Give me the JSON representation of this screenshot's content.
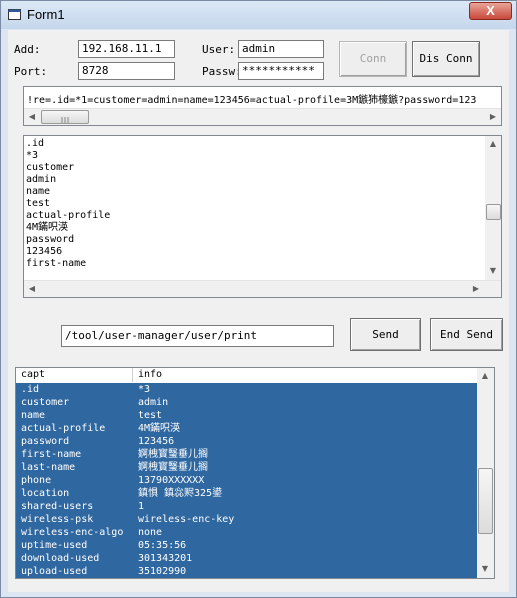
{
  "window": {
    "title": "Form1",
    "close_label": "X"
  },
  "conn": {
    "add_label": "Add:",
    "add_value": "192.168.11.1",
    "port_label": "Port:",
    "port_value": "8728",
    "user_label": "User:",
    "user_value": "admin",
    "pass_label": "Passw:",
    "pass_value": "***********",
    "conn_label": "Conn",
    "disconn_label": "Dis Conn"
  },
  "response_line": "!re=.id=*1=customer=admin=name=123456=actual-profile=3M鏃犻檺鏃?password=123",
  "response_list": [
    ".id",
    "*3",
    "customer",
    "admin",
    "name",
    "test",
    "actual-profile",
    "4M鏋呮渶",
    "password",
    "123456",
    "first-name"
  ],
  "command": {
    "value": "/tool/user-manager/user/print",
    "send_label": "Send",
    "end_send_label": "End Send"
  },
  "grid": {
    "col_capt": "capt",
    "col_info": "info",
    "rows": [
      [
        ".id",
        "*3"
      ],
      [
        "customer",
        "admin"
      ],
      [
        "name",
        "test"
      ],
      [
        "actual-profile",
        "4M鏋呮渶"
      ],
      [
        "password",
        "123456"
      ],
      [
        "first-name",
        "婀栧寳瑿垂儿搁"
      ],
      [
        "last-name",
        "婀栧寳瑿垂儿搁"
      ],
      [
        "phone",
        "13790XXXXXX"
      ],
      [
        "location",
        "鎮惧  鎮惢赆325鍙"
      ],
      [
        "shared-users",
        "1"
      ],
      [
        "wireless-psk",
        "wireless-enc-key"
      ],
      [
        "wireless-enc-algo",
        "none"
      ],
      [
        "uptime-used",
        "05:35:56"
      ],
      [
        "download-used",
        "301343201"
      ],
      [
        "upload-used",
        "35102990"
      ]
    ]
  }
}
